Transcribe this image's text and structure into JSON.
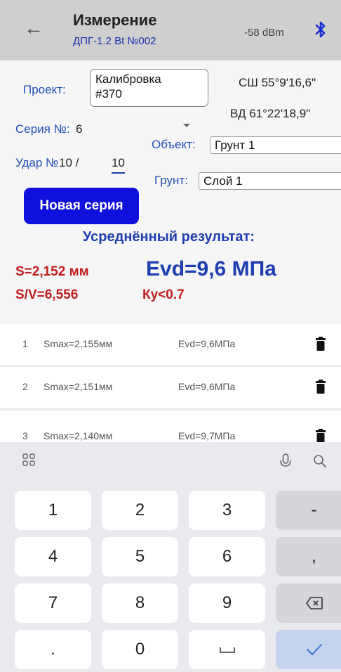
{
  "appbar": {
    "back_icon": "arrow-left-icon",
    "title": "Измерение",
    "subtitle": "ДПГ-1.2 Bt №002",
    "signal": "-58 dBm",
    "bluetooth_icon": "bluetooth-icon",
    "bluetooth_color": "#1a2fd0"
  },
  "form": {
    "project_label": "Проект:",
    "project_line1": "Калибровка",
    "project_line2": "#370",
    "lat": "СШ 55°9'16,6\"",
    "lon": "ВД 61°22'18,9\"",
    "series_label": "Серия №:",
    "series_value": "6",
    "object_label": "Объект:",
    "object_value": "Грунт 1",
    "hit_label": "Удар №",
    "hit_value": "10 /",
    "hit_total": "10",
    "soil_label": "Грунт:",
    "soil_value": "Слой 1",
    "new_series_button": "Новая серия",
    "avg_title": "Усреднённый результат:",
    "s_value": "S=2,152 мм",
    "sv_value": "S/V=6,556",
    "evd_value": "Evd=9,6 МПа",
    "ky_value": "Ку<0.7"
  },
  "list": [
    {
      "num": "1",
      "smax": "Smax=2,155мм",
      "evd": "Evd=9,6МПа"
    },
    {
      "num": "2",
      "smax": "Smax=2,151мм",
      "evd": "Evd=9,6МПа"
    },
    {
      "num": "3",
      "smax": "Smax=2,140мм",
      "evd": "Evd=9,7МПа"
    }
  ],
  "keyboard": {
    "keys": [
      "1",
      "2",
      "3",
      "-",
      "4",
      "5",
      "6",
      ",",
      "7",
      "8",
      "9",
      ".",
      "0"
    ]
  },
  "colors": {
    "accent_blue": "#1f3fb0",
    "button_blue": "#1010dc",
    "result_red": "#c01e1e"
  }
}
